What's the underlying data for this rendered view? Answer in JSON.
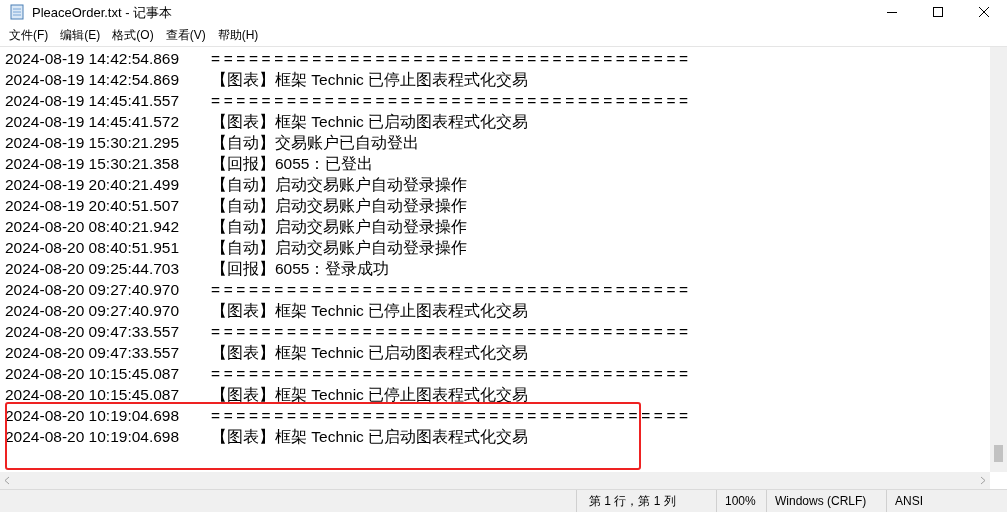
{
  "window": {
    "title": "PleaceOrder.txt - 记事本"
  },
  "menu": [
    "文件(F)",
    "编辑(E)",
    "格式(O)",
    "查看(V)",
    "帮助(H)"
  ],
  "lines": [
    {
      "time": "2024-08-19 14:42:54.869",
      "message": "======================================"
    },
    {
      "time": "2024-08-19 14:42:54.869",
      "message": "【图表】框架 Technic 已停止图表程式化交易"
    },
    {
      "time": "2024-08-19 14:45:41.557",
      "message": "======================================"
    },
    {
      "time": "2024-08-19 14:45:41.572",
      "message": "【图表】框架 Technic 已启动图表程式化交易"
    },
    {
      "time": "2024-08-19 15:30:21.295",
      "message": "【自动】交易账户已自动登出"
    },
    {
      "time": "2024-08-19 15:30:21.358",
      "message": "【回报】6055：已登出"
    },
    {
      "time": "2024-08-19 20:40:21.499",
      "message": "【自动】启动交易账户自动登录操作"
    },
    {
      "time": "2024-08-19 20:40:51.507",
      "message": "【自动】启动交易账户自动登录操作"
    },
    {
      "time": "2024-08-20 08:40:21.942",
      "message": "【自动】启动交易账户自动登录操作"
    },
    {
      "time": "2024-08-20 08:40:51.951",
      "message": "【自动】启动交易账户自动登录操作"
    },
    {
      "time": "2024-08-20 09:25:44.703",
      "message": "【回报】6055：登录成功"
    },
    {
      "time": "2024-08-20 09:27:40.970",
      "message": "======================================"
    },
    {
      "time": "2024-08-20 09:27:40.970",
      "message": "【图表】框架 Technic 已停止图表程式化交易"
    },
    {
      "time": "2024-08-20 09:47:33.557",
      "message": "======================================"
    },
    {
      "time": "2024-08-20 09:47:33.557",
      "message": "【图表】框架 Technic 已启动图表程式化交易"
    },
    {
      "time": "2024-08-20 10:15:45.087",
      "message": "======================================"
    },
    {
      "time": "2024-08-20 10:15:45.087",
      "message": "【图表】框架 Technic 已停止图表程式化交易"
    },
    {
      "time": "2024-08-20 10:19:04.698",
      "message": "======================================",
      "highlighted": true
    },
    {
      "time": "2024-08-20 10:19:04.698",
      "message": "【图表】框架 Technic 已启动图表程式化交易",
      "highlighted": true
    }
  ],
  "status_bar": {
    "position": "第 1 行，第 1 列",
    "zoom": "100%",
    "line_ending": "Windows (CRLF)",
    "encoding": "ANSI"
  }
}
